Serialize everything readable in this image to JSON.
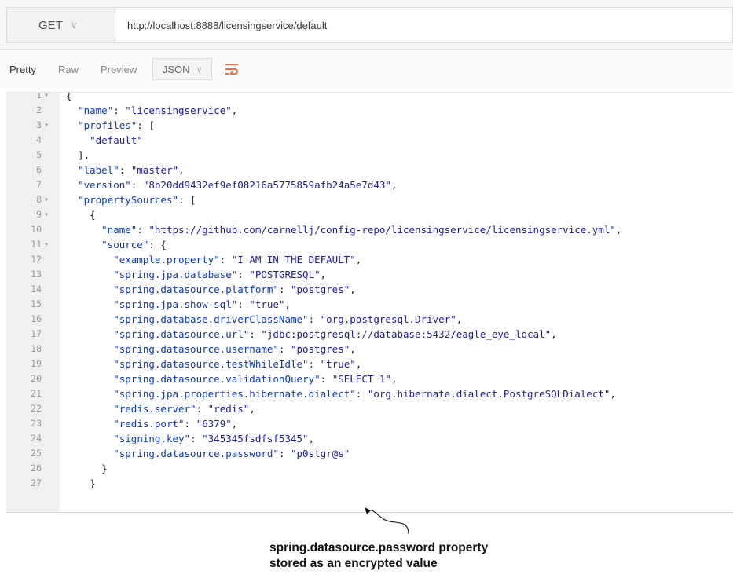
{
  "request": {
    "method": "GET",
    "url": "http://localhost:8888/licensingservice/default"
  },
  "response_toolbar": {
    "tabs": [
      "Pretty",
      "Raw",
      "Preview"
    ],
    "format": "JSON"
  },
  "code_lines": [
    {
      "n": "1",
      "fold": true,
      "segs": [
        {
          "t": "{",
          "c": "p"
        }
      ]
    },
    {
      "n": "2",
      "fold": false,
      "segs": [
        {
          "t": "  ",
          "c": "p"
        },
        {
          "t": "\"name\"",
          "c": "k"
        },
        {
          "t": ": ",
          "c": "p"
        },
        {
          "t": "\"licensingservice\"",
          "c": "s"
        },
        {
          "t": ",",
          "c": "p"
        }
      ]
    },
    {
      "n": "3",
      "fold": true,
      "segs": [
        {
          "t": "  ",
          "c": "p"
        },
        {
          "t": "\"profiles\"",
          "c": "k"
        },
        {
          "t": ": [",
          "c": "p"
        }
      ]
    },
    {
      "n": "4",
      "fold": false,
      "segs": [
        {
          "t": "    ",
          "c": "p"
        },
        {
          "t": "\"default\"",
          "c": "s"
        }
      ]
    },
    {
      "n": "5",
      "fold": false,
      "segs": [
        {
          "t": "  ],",
          "c": "p"
        }
      ]
    },
    {
      "n": "6",
      "fold": false,
      "segs": [
        {
          "t": "  ",
          "c": "p"
        },
        {
          "t": "\"label\"",
          "c": "k"
        },
        {
          "t": ": ",
          "c": "p"
        },
        {
          "t": "\"master\"",
          "c": "s"
        },
        {
          "t": ",",
          "c": "p"
        }
      ]
    },
    {
      "n": "7",
      "fold": false,
      "segs": [
        {
          "t": "  ",
          "c": "p"
        },
        {
          "t": "\"version\"",
          "c": "k"
        },
        {
          "t": ": ",
          "c": "p"
        },
        {
          "t": "\"8b20dd9432ef9ef08216a5775859afb24a5e7d43\"",
          "c": "s"
        },
        {
          "t": ",",
          "c": "p"
        }
      ]
    },
    {
      "n": "8",
      "fold": true,
      "segs": [
        {
          "t": "  ",
          "c": "p"
        },
        {
          "t": "\"propertySources\"",
          "c": "k"
        },
        {
          "t": ": [",
          "c": "p"
        }
      ]
    },
    {
      "n": "9",
      "fold": true,
      "segs": [
        {
          "t": "    {",
          "c": "p"
        }
      ]
    },
    {
      "n": "10",
      "fold": false,
      "segs": [
        {
          "t": "      ",
          "c": "p"
        },
        {
          "t": "\"name\"",
          "c": "k"
        },
        {
          "t": ": ",
          "c": "p"
        },
        {
          "t": "\"https://github.com/carnellj/config-repo/licensingservice/licensingservice.yml\"",
          "c": "s"
        },
        {
          "t": ",",
          "c": "p"
        }
      ]
    },
    {
      "n": "11",
      "fold": true,
      "segs": [
        {
          "t": "      ",
          "c": "p"
        },
        {
          "t": "\"source\"",
          "c": "k"
        },
        {
          "t": ": {",
          "c": "p"
        }
      ]
    },
    {
      "n": "12",
      "fold": false,
      "segs": [
        {
          "t": "        ",
          "c": "p"
        },
        {
          "t": "\"example.property\"",
          "c": "k"
        },
        {
          "t": ": ",
          "c": "p"
        },
        {
          "t": "\"I AM IN THE DEFAULT\"",
          "c": "s"
        },
        {
          "t": ",",
          "c": "p"
        }
      ]
    },
    {
      "n": "13",
      "fold": false,
      "segs": [
        {
          "t": "        ",
          "c": "p"
        },
        {
          "t": "\"spring.jpa.database\"",
          "c": "k"
        },
        {
          "t": ": ",
          "c": "p"
        },
        {
          "t": "\"POSTGRESQL\"",
          "c": "s"
        },
        {
          "t": ",",
          "c": "p"
        }
      ]
    },
    {
      "n": "14",
      "fold": false,
      "segs": [
        {
          "t": "        ",
          "c": "p"
        },
        {
          "t": "\"spring.datasource.platform\"",
          "c": "k"
        },
        {
          "t": ": ",
          "c": "p"
        },
        {
          "t": "\"postgres\"",
          "c": "s"
        },
        {
          "t": ",",
          "c": "p"
        }
      ]
    },
    {
      "n": "15",
      "fold": false,
      "segs": [
        {
          "t": "        ",
          "c": "p"
        },
        {
          "t": "\"spring.jpa.show-sql\"",
          "c": "k"
        },
        {
          "t": ": ",
          "c": "p"
        },
        {
          "t": "\"true\"",
          "c": "s"
        },
        {
          "t": ",",
          "c": "p"
        }
      ]
    },
    {
      "n": "16",
      "fold": false,
      "segs": [
        {
          "t": "        ",
          "c": "p"
        },
        {
          "t": "\"spring.database.driverClassName\"",
          "c": "k"
        },
        {
          "t": ": ",
          "c": "p"
        },
        {
          "t": "\"org.postgresql.Driver\"",
          "c": "s"
        },
        {
          "t": ",",
          "c": "p"
        }
      ]
    },
    {
      "n": "17",
      "fold": false,
      "segs": [
        {
          "t": "        ",
          "c": "p"
        },
        {
          "t": "\"spring.datasource.url\"",
          "c": "k"
        },
        {
          "t": ": ",
          "c": "p"
        },
        {
          "t": "\"jdbc:postgresql://database:5432/eagle_eye_local\"",
          "c": "s"
        },
        {
          "t": ",",
          "c": "p"
        }
      ]
    },
    {
      "n": "18",
      "fold": false,
      "segs": [
        {
          "t": "        ",
          "c": "p"
        },
        {
          "t": "\"spring.datasource.username\"",
          "c": "k"
        },
        {
          "t": ": ",
          "c": "p"
        },
        {
          "t": "\"postgres\"",
          "c": "s"
        },
        {
          "t": ",",
          "c": "p"
        }
      ]
    },
    {
      "n": "19",
      "fold": false,
      "segs": [
        {
          "t": "        ",
          "c": "p"
        },
        {
          "t": "\"spring.datasource.testWhileIdle\"",
          "c": "k"
        },
        {
          "t": ": ",
          "c": "p"
        },
        {
          "t": "\"true\"",
          "c": "s"
        },
        {
          "t": ",",
          "c": "p"
        }
      ]
    },
    {
      "n": "20",
      "fold": false,
      "segs": [
        {
          "t": "        ",
          "c": "p"
        },
        {
          "t": "\"spring.datasource.validationQuery\"",
          "c": "k"
        },
        {
          "t": ": ",
          "c": "p"
        },
        {
          "t": "\"SELECT 1\"",
          "c": "s"
        },
        {
          "t": ",",
          "c": "p"
        }
      ]
    },
    {
      "n": "21",
      "fold": false,
      "segs": [
        {
          "t": "        ",
          "c": "p"
        },
        {
          "t": "\"spring.jpa.properties.hibernate.dialect\"",
          "c": "k"
        },
        {
          "t": ": ",
          "c": "p"
        },
        {
          "t": "\"org.hibernate.dialect.PostgreSQLDialect\"",
          "c": "s"
        },
        {
          "t": ",",
          "c": "p"
        }
      ]
    },
    {
      "n": "22",
      "fold": false,
      "segs": [
        {
          "t": "        ",
          "c": "p"
        },
        {
          "t": "\"redis.server\"",
          "c": "k"
        },
        {
          "t": ": ",
          "c": "p"
        },
        {
          "t": "\"redis\"",
          "c": "s"
        },
        {
          "t": ",",
          "c": "p"
        }
      ]
    },
    {
      "n": "23",
      "fold": false,
      "segs": [
        {
          "t": "        ",
          "c": "p"
        },
        {
          "t": "\"redis.port\"",
          "c": "k"
        },
        {
          "t": ": ",
          "c": "p"
        },
        {
          "t": "\"6379\"",
          "c": "s"
        },
        {
          "t": ",",
          "c": "p"
        }
      ]
    },
    {
      "n": "24",
      "fold": false,
      "segs": [
        {
          "t": "        ",
          "c": "p"
        },
        {
          "t": "\"signing.key\"",
          "c": "k"
        },
        {
          "t": ": ",
          "c": "p"
        },
        {
          "t": "\"345345fsdfsf5345\"",
          "c": "s"
        },
        {
          "t": ",",
          "c": "p"
        }
      ]
    },
    {
      "n": "25",
      "fold": false,
      "segs": [
        {
          "t": "        ",
          "c": "p"
        },
        {
          "t": "\"spring.datasource.password\"",
          "c": "k"
        },
        {
          "t": ": ",
          "c": "p"
        },
        {
          "t": "\"p0stgr@s\"",
          "c": "s"
        }
      ]
    },
    {
      "n": "26",
      "fold": false,
      "segs": [
        {
          "t": "      }",
          "c": "p"
        }
      ]
    },
    {
      "n": "27",
      "fold": false,
      "segs": [
        {
          "t": "    }",
          "c": "p"
        }
      ]
    }
  ],
  "annotation": {
    "line1": "spring.datasource.password property",
    "line2": "stored as an encrypted value"
  }
}
